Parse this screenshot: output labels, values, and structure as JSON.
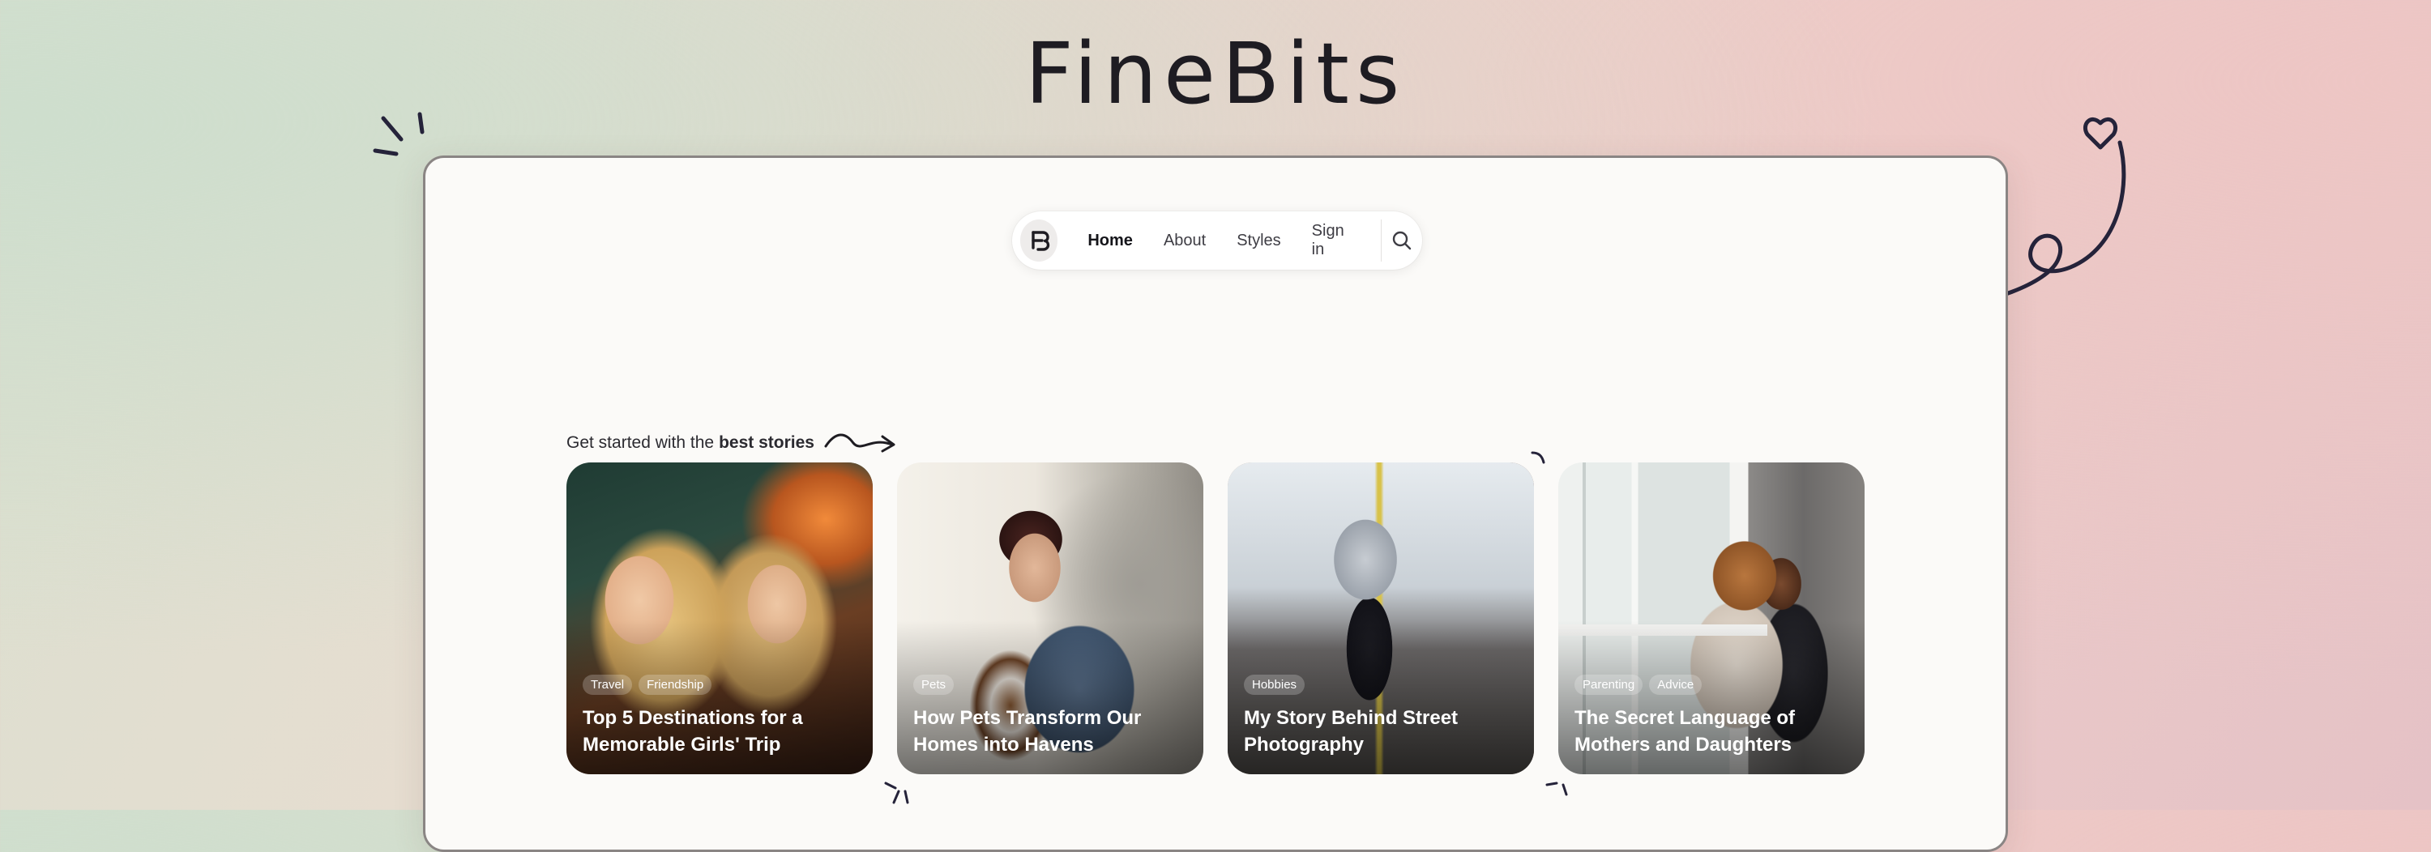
{
  "brand": {
    "title": "FineBits"
  },
  "nav": {
    "logo_icon": "finebits-logo-icon",
    "items": [
      {
        "label": "Home",
        "active": true
      },
      {
        "label": "About",
        "active": false
      },
      {
        "label": "Styles",
        "active": false
      },
      {
        "label": "Sign in",
        "active": false
      }
    ],
    "search_icon": "search-icon"
  },
  "section": {
    "heading_prefix": "Get started with the",
    "heading_emphasis": "best stories"
  },
  "stories": [
    {
      "tags": [
        "Travel",
        "Friendship"
      ],
      "title": "Top 5 Destinations for a Memorable Girls' Trip"
    },
    {
      "tags": [
        "Pets"
      ],
      "title": "How Pets Transform Our Homes into Havens"
    },
    {
      "tags": [
        "Hobbies"
      ],
      "title": "My Story Behind Street Photography"
    },
    {
      "tags": [
        "Parenting",
        "Advice"
      ],
      "title": "The Secret Language of Mothers and Daughters"
    }
  ],
  "colors": {
    "ink": "#25233a",
    "frame_bg": "#fbfaf8",
    "frame_border": "#8a8584"
  }
}
